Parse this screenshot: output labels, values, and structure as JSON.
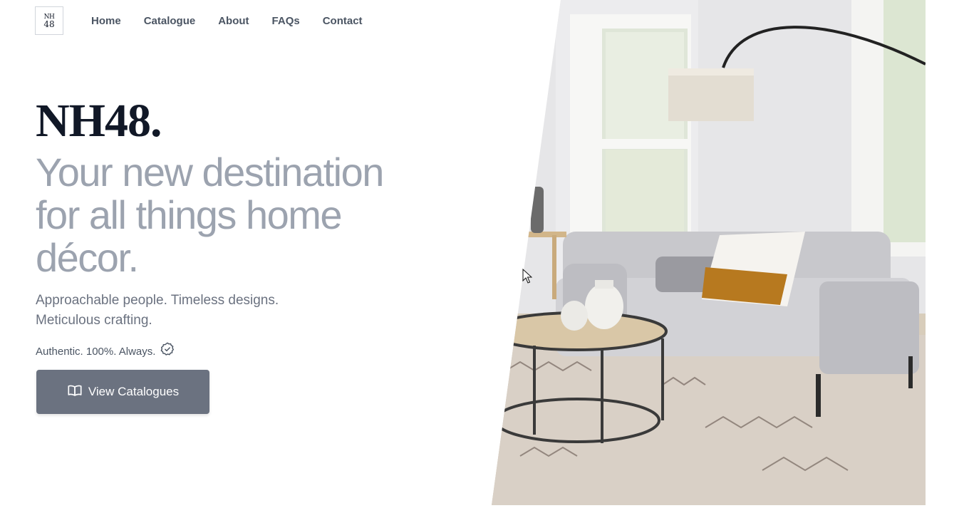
{
  "header": {
    "logo": {
      "line1": "NH",
      "line2": "48"
    },
    "nav": [
      {
        "label": "Home"
      },
      {
        "label": "Catalogue"
      },
      {
        "label": "About"
      },
      {
        "label": "FAQs"
      },
      {
        "label": "Contact"
      }
    ]
  },
  "hero": {
    "brand": "NH48.",
    "headline": "Your new destination for all things home décor.",
    "tagline": "Approachable people. Timeless designs. Meticulous crafting.",
    "authenticity": "Authentic. 100%. Always.",
    "authenticity_icon": "verified-badge-icon",
    "cta_label": "View Catalogues",
    "cta_icon": "open-book-icon"
  },
  "colors": {
    "brand_text": "#111827",
    "headline": "#9ca3af",
    "cta_bg": "#6b7280"
  }
}
